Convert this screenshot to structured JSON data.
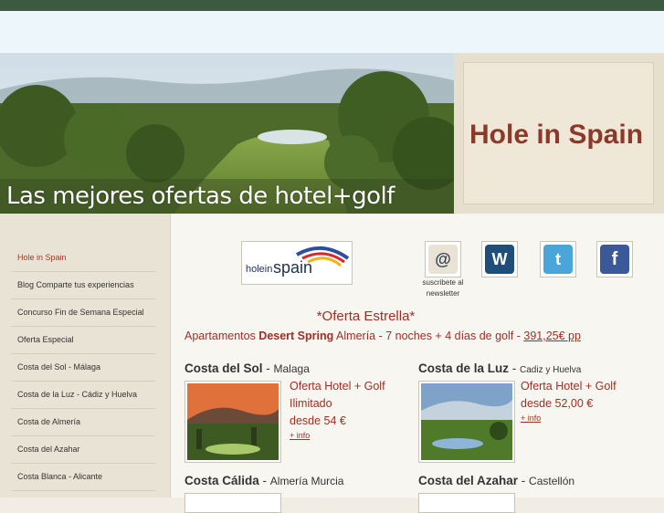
{
  "banner": {
    "headline": "Las mejores ofertas de hotel+golf"
  },
  "site": {
    "title": "Hole in Spain"
  },
  "sidebar": {
    "items": [
      {
        "label": "Hole in Spain"
      },
      {
        "label": "Blog Comparte tus experiencias"
      },
      {
        "label": "Concurso Fin de Semana Especial"
      },
      {
        "label": "Oferta Especial"
      },
      {
        "label": "Costa del Sol - Málaga"
      },
      {
        "label": "Costa de la Luz - Cádiz y Huelva"
      },
      {
        "label": "Costa de Almería"
      },
      {
        "label": "Costa del Azahar"
      },
      {
        "label": "Costa Blanca - Alicante"
      }
    ]
  },
  "logo": {
    "small": "holein",
    "big": "spain"
  },
  "newsletter": {
    "caption": "suscribete al newsletter"
  },
  "offer": {
    "title": "*Oferta Estrella*",
    "prefix": "Apartamentos ",
    "name": "Desert Spring",
    "details": " Almería - 7 noches + 4 días de golf - ",
    "price": "391,25€ pp"
  },
  "regions": [
    {
      "name": "Costa del Sol",
      "sep": " - ",
      "area": "Malaga",
      "deal1": "Oferta Hotel + Golf",
      "deal2": "Ilimitado",
      "deal3": "desde 54 €",
      "more": "+ info"
    },
    {
      "name": "Costa de la Luz",
      "sep": " - ",
      "area": "Cadiz y Huelva",
      "deal1": "Oferta Hotel + Golf",
      "deal2": "desde 52,00 €",
      "more": "+ info"
    },
    {
      "name": "Costa Cálida",
      "sep": " - ",
      "area": "Almería Murcia"
    },
    {
      "name": "Costa del Azahar",
      "sep": " - ",
      "area": "Castellón"
    }
  ],
  "colors": {
    "accent": "#9e2f22",
    "topbar": "#3c5a3f",
    "sidebar": "#e9e3d5"
  }
}
